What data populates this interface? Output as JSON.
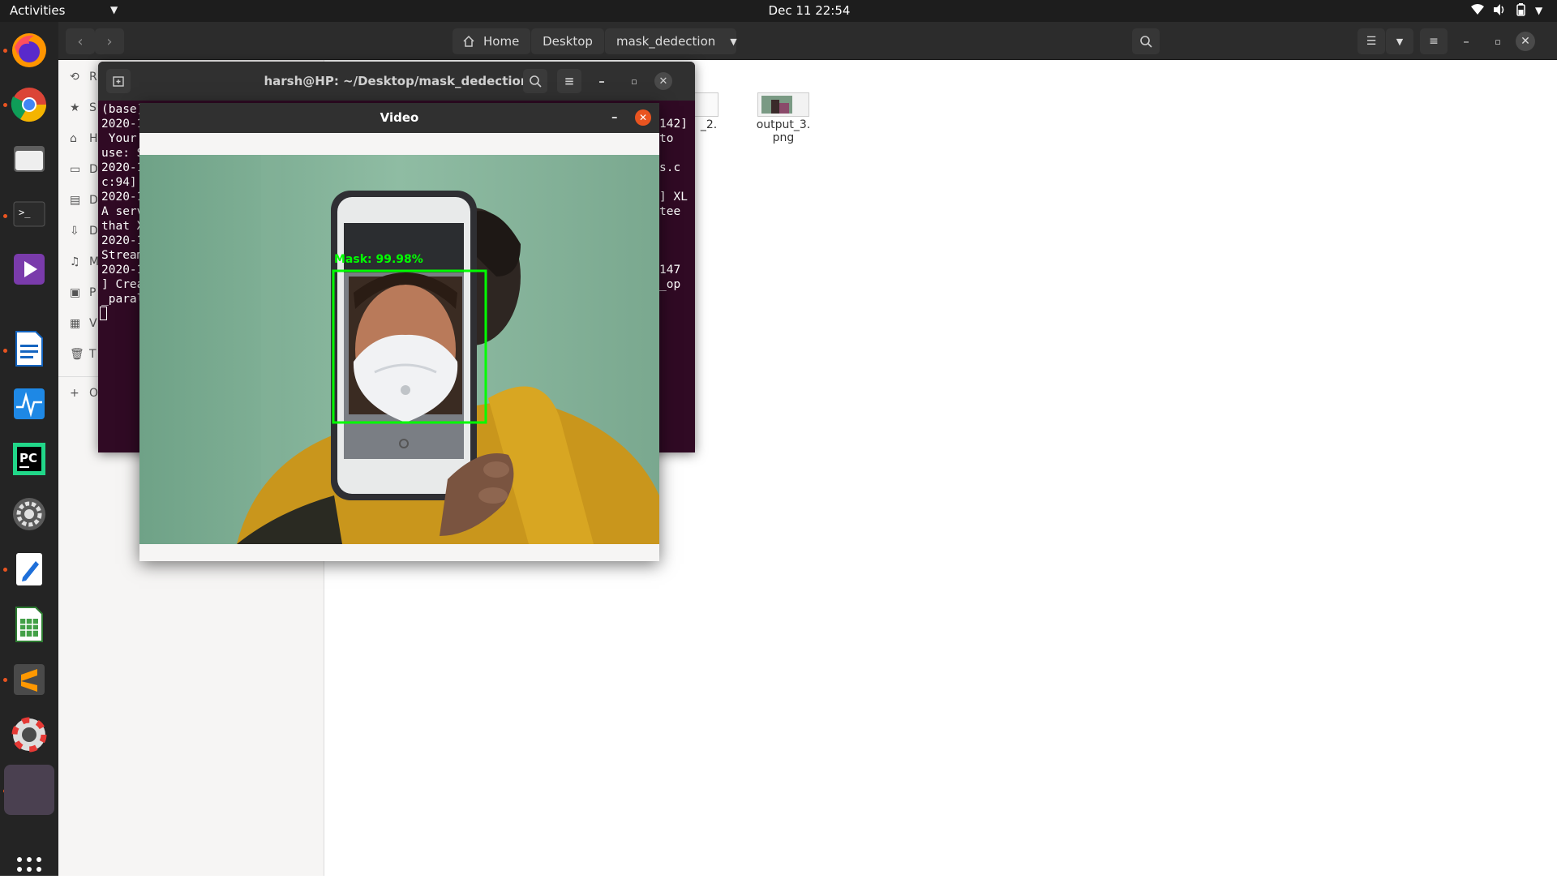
{
  "topbar": {
    "activities": "Activities",
    "clock": "Dec 11  22:54"
  },
  "dock": {
    "items": [
      "firefox-icon",
      "chrome-icon",
      "files-icon",
      "terminal-icon",
      "video-player-icon",
      "writer-icon",
      "system-monitor-icon",
      "pycharm-icon",
      "settings-icon",
      "text-editor-icon",
      "calc-icon",
      "sublime-text-icon",
      "help-icon",
      "running-app-icon"
    ],
    "show_apps": "show-applications-icon"
  },
  "file_manager": {
    "path": [
      "Home",
      "Desktop",
      "mask_dedection"
    ],
    "sidebar": [
      "R",
      "S",
      "H",
      "D",
      "D",
      "D",
      "M",
      "P",
      "V",
      "T",
      "O"
    ],
    "files": [
      {
        "name_line1": "_2.",
        "name_line2": ""
      },
      {
        "name_line1": "output_3.",
        "name_line2": "png"
      }
    ]
  },
  "terminal": {
    "title": "harsh@HP: ~/Desktop/mask_dedection",
    "left_lines": [
      "(base)",
      "2020-1",
      " Your",
      "use: S",
      "2020-1",
      "c:94]",
      "2020-1",
      "A serv",
      "that X",
      "2020-1",
      "Stream",
      "2020-1",
      "] Crea",
      "_paral"
    ],
    "right_lines": [
      {
        "row": 1,
        "text": "142]"
      },
      {
        "row": 2,
        "text": "to"
      },
      {
        "row": 4,
        "text": "s.c"
      },
      {
        "row": 6,
        "text": "] XL"
      },
      {
        "row": 7,
        "text": "tee"
      },
      {
        "row": 11,
        "text": "147"
      },
      {
        "row": 12,
        "text": "_op"
      }
    ]
  },
  "video": {
    "title": "Video",
    "detection_label": "Mask: 99.98%",
    "detection_color": "#00ff00"
  },
  "colors": {
    "terminal_bg": "#300a24",
    "accent": "#e95420",
    "topbar": "#1d1d1d",
    "dock": "#242424"
  }
}
